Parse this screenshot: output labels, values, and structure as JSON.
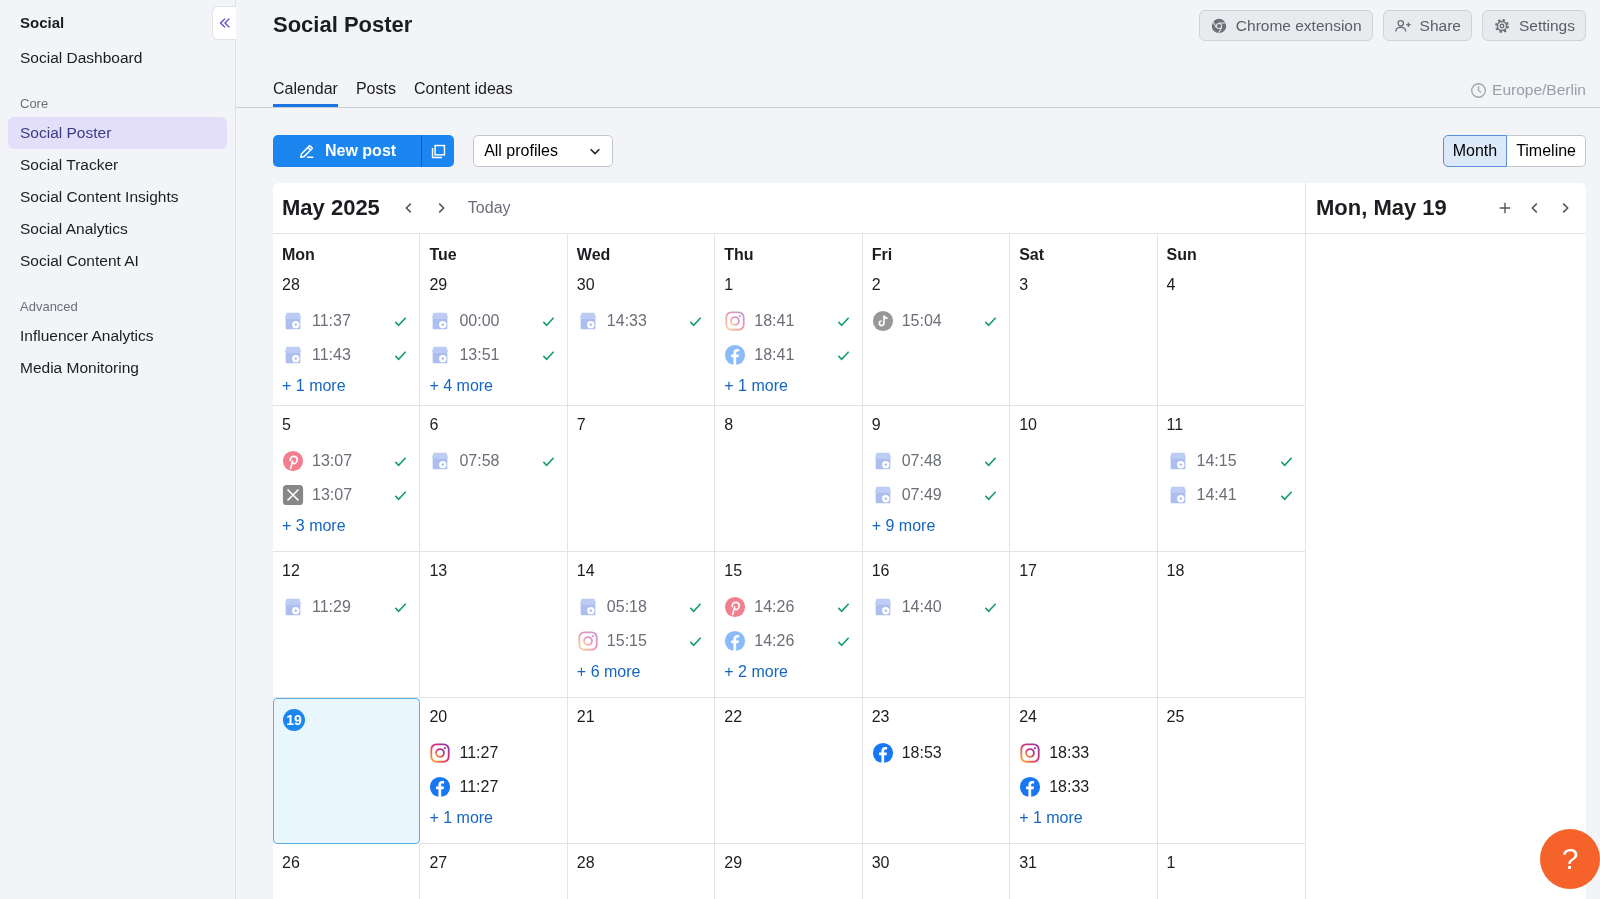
{
  "sidebar": {
    "title": "Social",
    "groups": [
      {
        "items": [
          {
            "label": "Social Dashboard",
            "selected": false
          }
        ]
      },
      {
        "heading": "Core",
        "items": [
          {
            "label": "Social Poster",
            "selected": true
          },
          {
            "label": "Social Tracker",
            "selected": false
          },
          {
            "label": "Social Content Insights",
            "selected": false
          },
          {
            "label": "Social Analytics",
            "selected": false
          },
          {
            "label": "Social Content AI",
            "selected": false
          }
        ]
      },
      {
        "heading": "Advanced",
        "items": [
          {
            "label": "Influencer Analytics",
            "selected": false
          },
          {
            "label": "Media Monitoring",
            "selected": false
          }
        ]
      }
    ]
  },
  "page": {
    "title": "Social Poster",
    "actions": [
      {
        "kind": "chrome",
        "label": "Chrome extension"
      },
      {
        "kind": "share",
        "label": "Share"
      },
      {
        "kind": "settings",
        "label": "Settings"
      }
    ]
  },
  "tabs": [
    {
      "label": "Calendar",
      "selected": true
    },
    {
      "label": "Posts",
      "selected": false
    },
    {
      "label": "Content ideas",
      "selected": false
    }
  ],
  "timezone": "Europe/Berlin",
  "toolbar": {
    "new_post": "New post",
    "profiles": "All profiles",
    "views": [
      {
        "label": "Month",
        "selected": true
      },
      {
        "label": "Timeline",
        "selected": false
      }
    ]
  },
  "calendar": {
    "month": "May 2025",
    "today_button": "Today",
    "weekdays": [
      "Mon",
      "Tue",
      "Wed",
      "Thu",
      "Fri",
      "Sat",
      "Sun"
    ],
    "weeks": [
      [
        {
          "day": "28",
          "today": false,
          "posts": [
            {
              "kind": "gbp",
              "time": "11:37",
              "published": true
            },
            {
              "kind": "gbp",
              "time": "11:43",
              "published": true
            }
          ],
          "more": "+ 1 more"
        },
        {
          "day": "29",
          "today": false,
          "posts": [
            {
              "kind": "gbp",
              "time": "00:00",
              "published": true
            },
            {
              "kind": "gbp",
              "time": "13:51",
              "published": true
            }
          ],
          "more": "+ 4 more"
        },
        {
          "day": "30",
          "today": false,
          "posts": [
            {
              "kind": "gbp",
              "time": "14:33",
              "published": true
            }
          ]
        },
        {
          "day": "1",
          "today": false,
          "posts": [
            {
              "kind": "instagram",
              "time": "18:41",
              "published": true
            },
            {
              "kind": "facebook",
              "time": "18:41",
              "published": true
            }
          ],
          "more": "+ 1 more"
        },
        {
          "day": "2",
          "today": false,
          "posts": [
            {
              "kind": "tiktok",
              "time": "15:04",
              "published": true
            }
          ]
        },
        {
          "day": "3",
          "today": false
        },
        {
          "day": "4",
          "today": false
        }
      ],
      [
        {
          "day": "5",
          "today": false,
          "posts": [
            {
              "kind": "pinterest",
              "time": "13:07",
              "published": true
            },
            {
              "kind": "x",
              "time": "13:07",
              "published": true
            }
          ],
          "more": "+ 3 more"
        },
        {
          "day": "6",
          "today": false,
          "posts": [
            {
              "kind": "gbp",
              "time": "07:58",
              "published": true
            }
          ]
        },
        {
          "day": "7",
          "today": false
        },
        {
          "day": "8",
          "today": false
        },
        {
          "day": "9",
          "today": false,
          "posts": [
            {
              "kind": "gbp",
              "time": "07:48",
              "published": true
            },
            {
              "kind": "gbp",
              "time": "07:49",
              "published": true
            }
          ],
          "more": "+ 9 more"
        },
        {
          "day": "10",
          "today": false
        },
        {
          "day": "11",
          "today": false,
          "posts": [
            {
              "kind": "gbp",
              "time": "14:15",
              "published": true
            },
            {
              "kind": "gbp",
              "time": "14:41",
              "published": true
            }
          ]
        }
      ],
      [
        {
          "day": "12",
          "today": false,
          "posts": [
            {
              "kind": "gbp",
              "time": "11:29",
              "published": true
            }
          ]
        },
        {
          "day": "13",
          "today": false
        },
        {
          "day": "14",
          "today": false,
          "posts": [
            {
              "kind": "gbp",
              "time": "05:18",
              "published": true
            },
            {
              "kind": "instagram",
              "time": "15:15",
              "published": true
            }
          ],
          "more": "+ 6 more"
        },
        {
          "day": "15",
          "today": false,
          "posts": [
            {
              "kind": "pinterest",
              "time": "14:26",
              "published": true
            },
            {
              "kind": "facebook",
              "time": "14:26",
              "published": true
            }
          ],
          "more": "+ 2 more"
        },
        {
          "day": "16",
          "today": false,
          "posts": [
            {
              "kind": "gbp",
              "time": "14:40",
              "published": true
            }
          ]
        },
        {
          "day": "17",
          "today": false
        },
        {
          "day": "18",
          "today": false
        }
      ],
      [
        {
          "day": "19",
          "today": true
        },
        {
          "day": "20",
          "today": false,
          "posts": [
            {
              "kind": "instagram",
              "time": "11:27",
              "published": false
            },
            {
              "kind": "facebook",
              "time": "11:27",
              "published": false
            }
          ],
          "more": "+ 1 more"
        },
        {
          "day": "21",
          "today": false
        },
        {
          "day": "22",
          "today": false
        },
        {
          "day": "23",
          "today": false,
          "posts": [
            {
              "kind": "facebook",
              "time": "18:53",
              "published": false
            }
          ]
        },
        {
          "day": "24",
          "today": false,
          "posts": [
            {
              "kind": "instagram",
              "time": "18:33",
              "published": false
            },
            {
              "kind": "facebook",
              "time": "18:33",
              "published": false
            }
          ],
          "more": "+ 1 more"
        },
        {
          "day": "25",
          "today": false
        }
      ],
      [
        {
          "day": "26",
          "today": false
        },
        {
          "day": "27",
          "today": false
        },
        {
          "day": "28",
          "today": false
        },
        {
          "day": "29",
          "today": false
        },
        {
          "day": "30",
          "today": false
        },
        {
          "day": "31",
          "today": false
        },
        {
          "day": "1",
          "today": false
        }
      ]
    ]
  },
  "day_panel": {
    "title": "Mon, May 19"
  },
  "help": "?"
}
